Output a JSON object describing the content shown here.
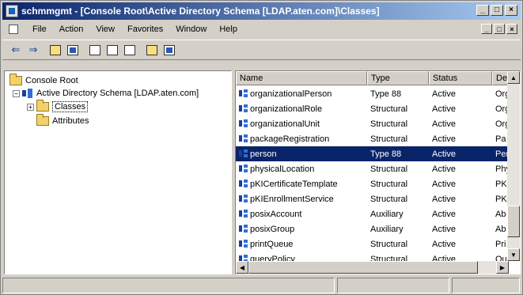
{
  "window": {
    "title": "schmmgmt - [Console Root\\Active Directory Schema [LDAP.aten.com]\\Classes]",
    "title_buttons": [
      "_",
      "□",
      "×"
    ],
    "mdi_buttons": [
      "_",
      "□",
      "×"
    ]
  },
  "menu": {
    "items": [
      "File",
      "Action",
      "View",
      "Favorites",
      "Window",
      "Help"
    ]
  },
  "toolbar": {
    "buttons": [
      "back-arrow-icon",
      "forward-arrow-icon",
      "up-folder-icon",
      "show-tree-icon",
      "properties-icon",
      "export-icon",
      "refresh-icon",
      "help-icon",
      "console-icon"
    ],
    "back": "⇐",
    "forward": "⇒"
  },
  "tree": {
    "root": "Console Root",
    "schema": "Active Directory Schema [LDAP.aten.com]",
    "classes": "Classes",
    "attributes": "Attributes",
    "expand_minus": "−",
    "expand_plus": "+"
  },
  "list": {
    "columns": [
      "Name",
      "Type",
      "Status",
      "De"
    ],
    "rows": [
      {
        "name": "organizationalPerson",
        "type": "Type 88",
        "status": "Active",
        "desc": "Org"
      },
      {
        "name": "organizationalRole",
        "type": "Structural",
        "status": "Active",
        "desc": "Org"
      },
      {
        "name": "organizationalUnit",
        "type": "Structural",
        "status": "Active",
        "desc": "Org"
      },
      {
        "name": "packageRegistration",
        "type": "Structural",
        "status": "Active",
        "desc": "Pa"
      },
      {
        "name": "person",
        "type": "Type 88",
        "status": "Active",
        "desc": "Per",
        "selected": true
      },
      {
        "name": "physicalLocation",
        "type": "Structural",
        "status": "Active",
        "desc": "Phy"
      },
      {
        "name": "pKICertificateTemplate",
        "type": "Structural",
        "status": "Active",
        "desc": "PKI"
      },
      {
        "name": "pKIEnrollmentService",
        "type": "Structural",
        "status": "Active",
        "desc": "PKI"
      },
      {
        "name": "posixAccount",
        "type": "Auxiliary",
        "status": "Active",
        "desc": "Ab"
      },
      {
        "name": "posixGroup",
        "type": "Auxiliary",
        "status": "Active",
        "desc": "Ab"
      },
      {
        "name": "printQueue",
        "type": "Structural",
        "status": "Active",
        "desc": "Pri"
      },
      {
        "name": "queryPolicy",
        "type": "Structural",
        "status": "Active",
        "desc": "Qu"
      }
    ]
  },
  "colors": {
    "title_start": "#0a246a",
    "title_end": "#a6caf0",
    "selection": "#0a246a",
    "chrome": "#d4d0c8"
  }
}
